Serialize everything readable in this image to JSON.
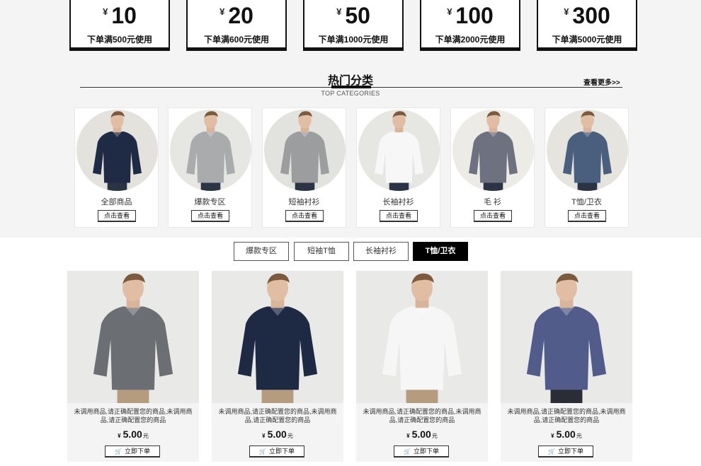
{
  "coupons": [
    {
      "currency": "¥",
      "amount": "10",
      "condition": "下单满500元使用"
    },
    {
      "currency": "¥",
      "amount": "20",
      "condition": "下单满600元使用"
    },
    {
      "currency": "¥",
      "amount": "50",
      "condition": "下单满1000元使用"
    },
    {
      "currency": "¥",
      "amount": "100",
      "condition": "下单满2000元使用"
    },
    {
      "currency": "¥",
      "amount": "300",
      "condition": "下单满5000元使用"
    }
  ],
  "section": {
    "title": "热门分类",
    "subtitle": "TOP CATEGORIES",
    "more": "查看更多>>"
  },
  "categories": [
    {
      "name": "全部商品",
      "button": "点击查看",
      "shirt_color": "#1f2a44",
      "bg": "#e4e2dc"
    },
    {
      "name": "爆款专区",
      "button": "点击查看",
      "shirt_color": "#a9abad",
      "bg": "#e6e6e2"
    },
    {
      "name": "短袖衬衫",
      "button": "点击查看",
      "shirt_color": "#9b9d9f",
      "bg": "#e2e2de"
    },
    {
      "name": "长袖衬衫",
      "button": "点击查看",
      "shirt_color": "#f7f7f7",
      "bg": "#e6e6e2"
    },
    {
      "name": "毛 衫",
      "button": "点击查看",
      "shirt_color": "#6d7180",
      "bg": "#ecebe6"
    },
    {
      "name": "T恤/卫衣",
      "button": "点击查看",
      "shirt_color": "#4a5f7e",
      "bg": "#e5e4df"
    }
  ],
  "tabs": [
    {
      "label": "爆款专区",
      "active": false
    },
    {
      "label": "短袖T恤",
      "active": false
    },
    {
      "label": "长袖衬衫",
      "active": false
    },
    {
      "label": "T恤/卫衣",
      "active": true
    }
  ],
  "products": [
    {
      "desc": "未调用商品,请正确配置您的商品,未调用商品,请正确配置您的商品",
      "currency": "¥",
      "price": "5.00",
      "unit": "元",
      "buy": "立即下单",
      "shirt_color": "#6b6e72",
      "pants_color": "#b59c7e"
    },
    {
      "desc": "未调用商品,请正确配置您的商品,未调用商品,请正确配置您的商品",
      "currency": "¥",
      "price": "5.00",
      "unit": "元",
      "buy": "立即下单",
      "shirt_color": "#1e2a44",
      "pants_color": "#b59c7e"
    },
    {
      "desc": "未调用商品,请正确配置您的商品,未调用商品,请正确配置您的商品",
      "currency": "¥",
      "price": "5.00",
      "unit": "元",
      "buy": "立即下单",
      "shirt_color": "#f6f6f6",
      "pants_color": "#b59c7e"
    },
    {
      "desc": "未调用商品,请正确配置您的商品,未调用商品,请正确配置您的商品",
      "currency": "¥",
      "price": "5.00",
      "unit": "元",
      "buy": "立即下单",
      "shirt_color": "#525c8a",
      "pants_color": "#2a2d36"
    }
  ]
}
